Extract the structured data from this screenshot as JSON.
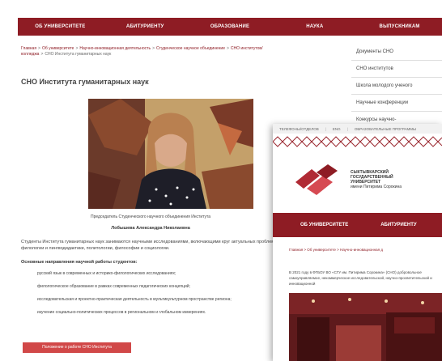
{
  "topnav": {
    "items": [
      "ОБ УНИВЕРСИТЕТЕ",
      "АБИТУРИЕНТУ",
      "ОБРАЗОВАНИЕ",
      "НАУКА",
      "ВЫПУСКНИКАМ"
    ]
  },
  "breadcrumb": {
    "items": [
      "Главная",
      "Об университете",
      "Научно-инновационная деятельность",
      "Студенческое научное объединение",
      "СНО институтов/колледжа"
    ],
    "current": "СНО Института гуманитарных наук"
  },
  "page_title": "СНО Института гуманитарных наук",
  "photo": {
    "caption": "Председатель Студенческого научного объединения Института",
    "person_name": "Лобышева Александра Николаевна"
  },
  "intro": "Студенты Института гуманитарных наук занимаются научными исследованиями, включающими круг актуальных проблем филологии и лингводидактики, политологии, философии и социологии.",
  "directions": {
    "title": "Основные направления научной работы студентов:",
    "items": [
      "русский язык в современных и историко-филологических исследованиях;",
      "филологическое образование в рамках современных педагогических концепций;",
      "исследовательская и проектно-практическая деятельность в мультикультурном пространстве региона;",
      "изучение социально-политических процессов в региональном и глобальном измерениях."
    ]
  },
  "rules_button": "Положение о работе СНО Института",
  "sidebar": {
    "items": [
      "Документы СНО",
      "СНО институтов",
      "Школа молодого ученого",
      "Научные конференции",
      "Конкурсы научно-"
    ]
  },
  "popup": {
    "top_links": [
      "ТЕЛЕФОНЫ/ОТДЕЛОВ",
      "ENG",
      "ОБРАЗОВАТЕЛЬНЫЕ ПРОГРАММЫ"
    ],
    "logo_lines": [
      "СЫКТЫВКАРСКИЙ",
      "ГОСУДАРСТВЕННЫЙ",
      "УНИВЕРСИТЕТ"
    ],
    "logo_sub": "имени Питирима Сорокина",
    "nav_items": [
      "ОБ УНИВЕРСИТЕТЕ",
      "АБИТУРИЕНТУ"
    ],
    "breadcrumb": "Главная > Об университете > Научно-инновационная д",
    "text": "В 2021 году в ФГБОУ ВО «СГУ им. Питирима Сорокина» (СНО) добровольное самоуправляемое, некоммерческое исследовательской, научно-просветительской и инновационной"
  },
  "colors": {
    "brand": "#8e1c24",
    "button": "#d14848"
  }
}
